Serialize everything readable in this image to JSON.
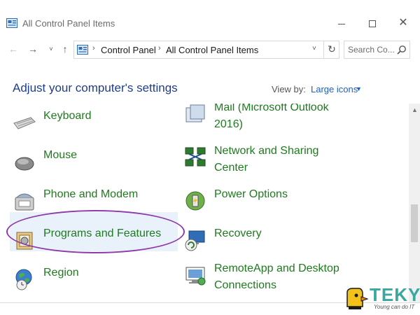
{
  "window": {
    "title": "All Control Panel Items",
    "minimize_glyph": "",
    "close_glyph": "✕"
  },
  "nav": {
    "back_glyph": "←",
    "forward_glyph": "→",
    "recent_glyph": "˅",
    "up_glyph": "↑",
    "address_parts": [
      "Control Panel",
      "All Control Panel Items"
    ],
    "separator_glyph": "›",
    "dropdown_glyph": "˅",
    "refresh_glyph": "↻",
    "search_placeholder": "Search Co..."
  },
  "header": {
    "title": "Adjust your computer's settings",
    "view_by_label": "View by:",
    "view_by_value": "Large icons",
    "caret_glyph": "▼"
  },
  "items": {
    "col1": [
      {
        "label": "Keyboard",
        "icon": "keyboard-icon"
      },
      {
        "label": "Mouse",
        "icon": "mouse-icon"
      },
      {
        "label": "Phone and Modem",
        "icon": "phone-modem-icon"
      },
      {
        "label": "Programs and Features",
        "icon": "programs-features-icon"
      },
      {
        "label": "Region",
        "icon": "region-icon"
      }
    ],
    "col2": [
      {
        "label": "Mail (Microsoft Outlook 2016)",
        "icon": "mail-icon"
      },
      {
        "label": "Network and Sharing Center",
        "icon": "network-sharing-icon"
      },
      {
        "label": "Power Options",
        "icon": "power-options-icon"
      },
      {
        "label": "Recovery",
        "icon": "recovery-icon"
      },
      {
        "label": "RemoteApp and Desktop Connections",
        "icon": "remoteapp-icon"
      }
    ]
  },
  "scrollbar": {
    "up_glyph": "▲"
  },
  "logo": {
    "text": "TEKY",
    "sub": "Young can do IT"
  },
  "colors": {
    "link_green": "#1f7a1f",
    "heading_blue": "#1e3e8c",
    "accent_blue": "#1f5ec4",
    "highlight_oval": "#8e3aa8"
  }
}
